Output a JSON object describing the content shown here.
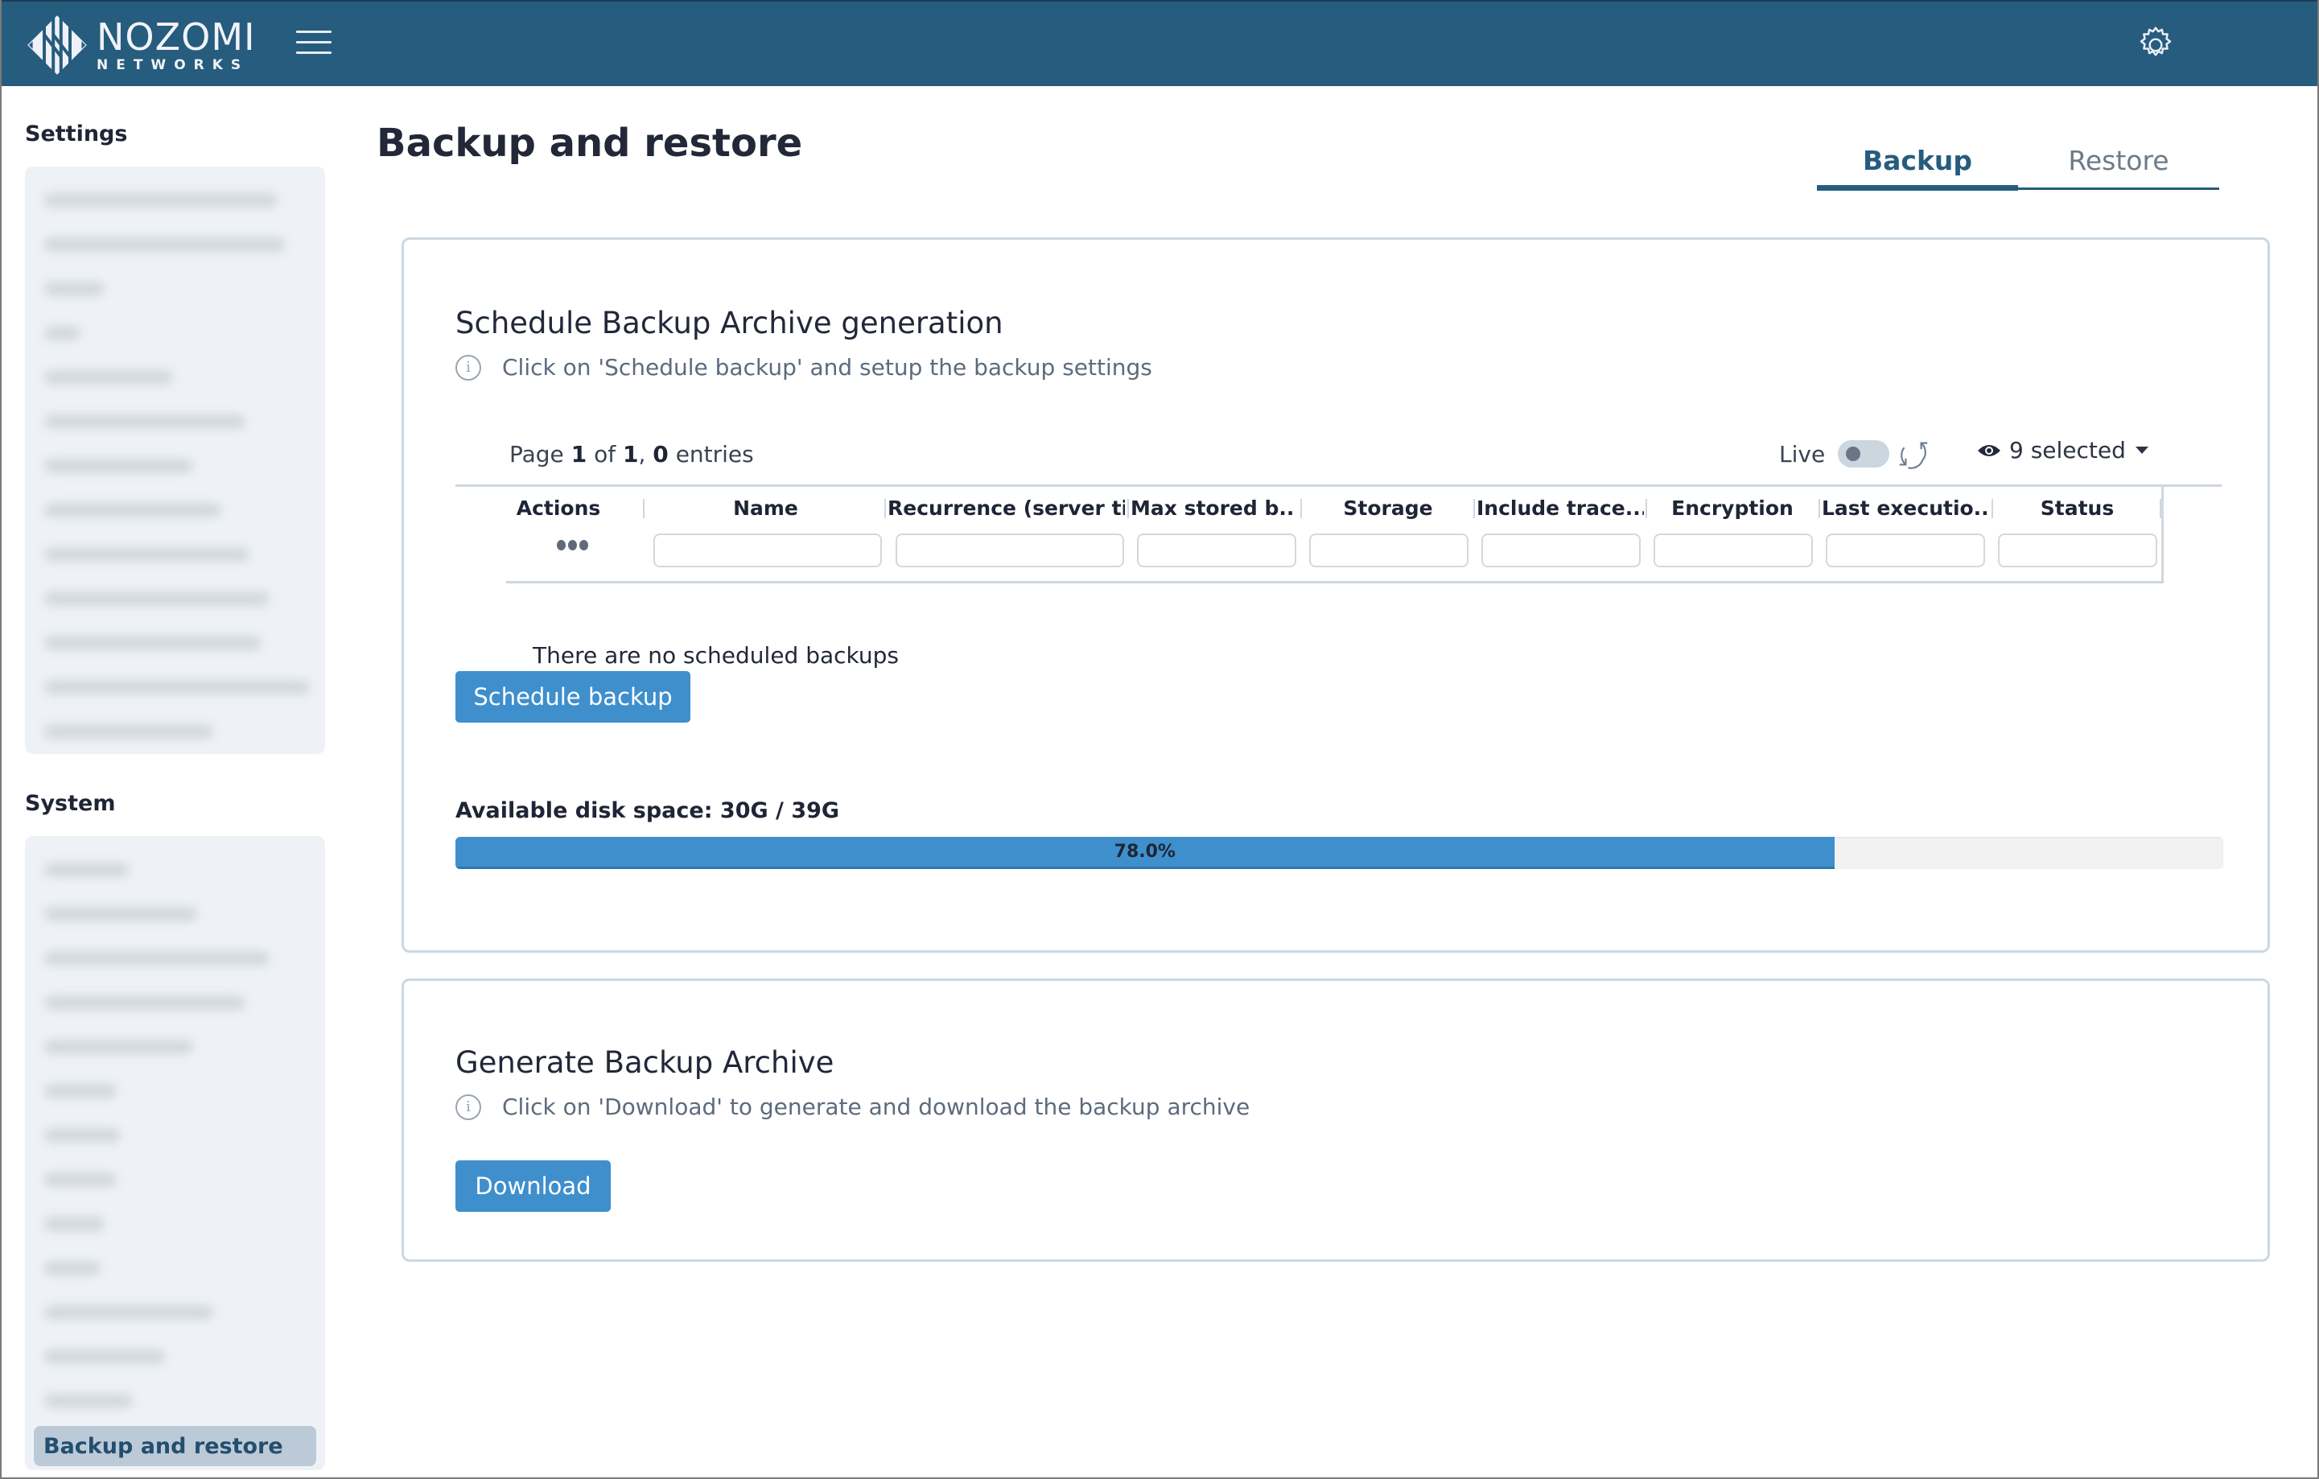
{
  "header": {
    "brand_line1": "NOZOMI",
    "brand_line2": "NETWORKS",
    "menu_icon": "hamburger-icon",
    "settings_icon": "gear-icon"
  },
  "sidebar": {
    "sections": [
      {
        "title": "Settings",
        "items_blurred": 13
      },
      {
        "title": "System",
        "items_blurred": 13,
        "active_item": "Backup and restore"
      }
    ]
  },
  "page": {
    "title": "Backup and restore",
    "tabs": [
      {
        "label": "Backup",
        "active": true
      },
      {
        "label": "Restore",
        "active": false
      }
    ]
  },
  "schedule_card": {
    "title": "Schedule Backup Archive generation",
    "hint": "Click on 'Schedule backup' and setup the backup settings",
    "pager": {
      "prefix": "Page",
      "page": "1",
      "of_word": "of",
      "total_pages": "1",
      "entries": "0",
      "entries_word": "entries"
    },
    "live_label": "Live",
    "live_enabled": false,
    "columns_selected": "9 selected",
    "columns": [
      "Actions",
      "Name",
      "Recurrence (server ti...",
      "Max stored b...",
      "Storage",
      "Include trace...",
      "Encryption",
      "Last executio...",
      "Status"
    ],
    "filters": [
      "",
      "",
      "",
      "",
      "",
      "",
      "",
      ""
    ],
    "empty_message": "There are no scheduled backups",
    "schedule_button": "Schedule backup",
    "disk_label": "Available disk space: 30G / 39G",
    "disk_percent": 78.0,
    "disk_percent_label": "78.0%",
    "accent_color": "#3f8fcd"
  },
  "generate_card": {
    "title": "Generate Backup Archive",
    "hint": "Click on 'Download' to generate and download the backup archive",
    "download_button": "Download"
  }
}
